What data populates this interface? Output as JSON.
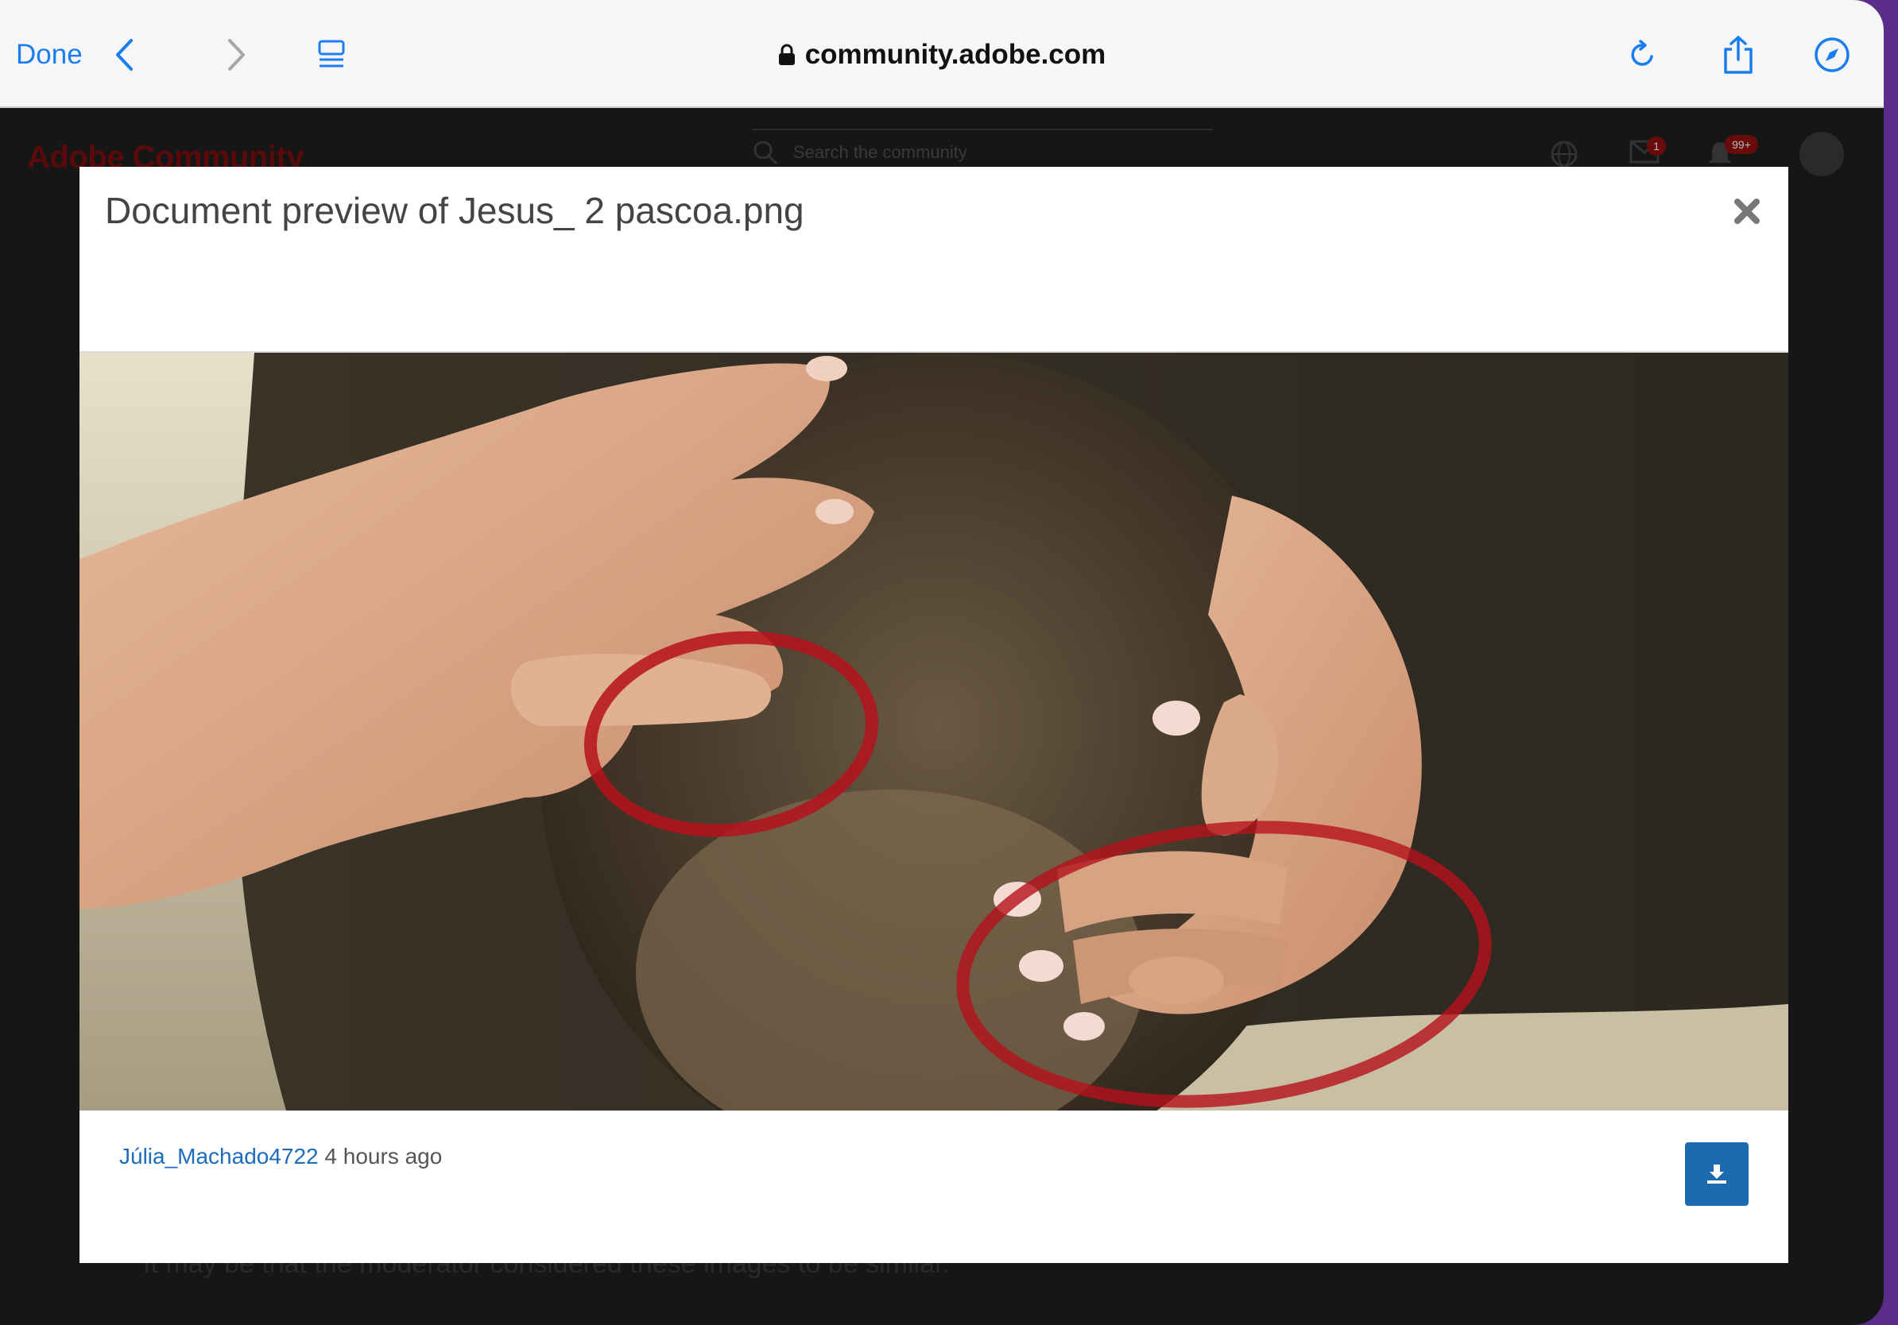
{
  "browser": {
    "done_label": "Done",
    "url": "community.adobe.com"
  },
  "background_page": {
    "brand": "Adobe Community",
    "search_placeholder": "Search the community",
    "messages_badge": "1",
    "notifications_badge": "99+",
    "partial_text": "It may be that the moderator considered these images to be similar."
  },
  "modal": {
    "title": "Document preview of Jesus_ 2 pascoa.png",
    "author": "Júlia_Machado4722",
    "timestamp": "4 hours ago"
  },
  "colors": {
    "link": "#1c6cbd",
    "download_button": "#1d6ab0",
    "accent": "#1a7ef0",
    "annotation_circle": "#b5121b"
  }
}
